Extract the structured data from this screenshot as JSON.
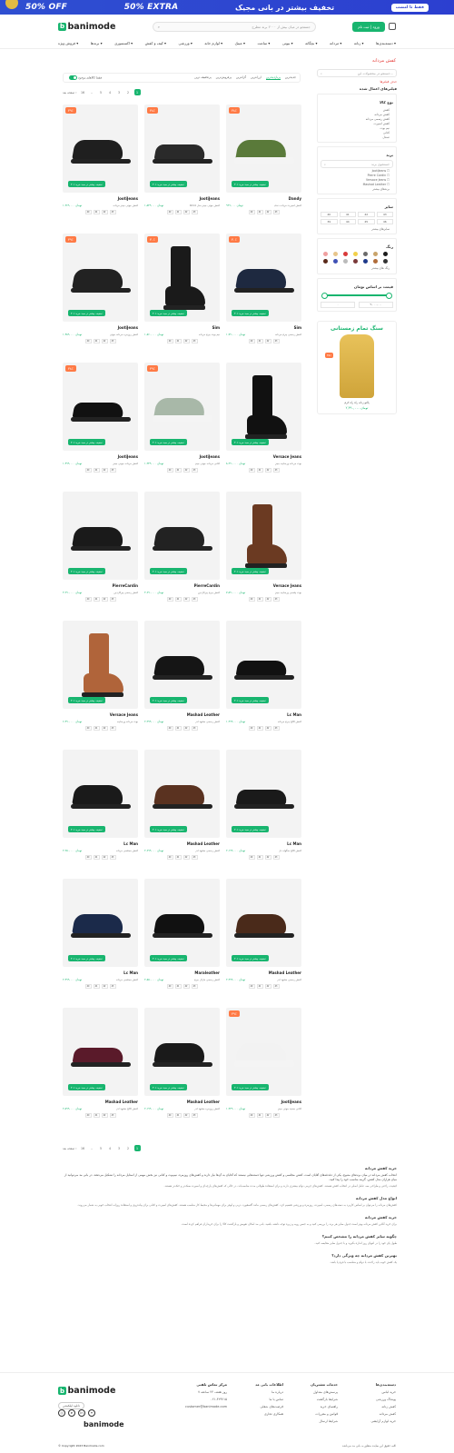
{
  "banner": {
    "cta": "فقط تا امشب",
    "headline": "تخفیف بیشتر در بانی مجیک",
    "extra": "50% EXTRA",
    "off": "50% OFF"
  },
  "header": {
    "logo": "banimode",
    "search_placeholder": "جستجو در میان بیش از ۲۰۰۰ برند مطرح",
    "login": "ورود | ثبت نام"
  },
  "nav": [
    "دسته‌بندی‌ها",
    "زنانه",
    "مردانه",
    "بچگانه",
    "بیوتی",
    "ساعت",
    "عینک",
    "لوازم خانه",
    "ورزشی",
    "کیف و کفش",
    "اکسسوری",
    "برندها",
    "فروش ویژه"
  ],
  "page_title": "کفش مردانه",
  "sidebar": {
    "search_placeholder": "جستجو در محصولات این...",
    "clear": "حذف فیلترها",
    "active_filters": "فیلترهای اعمال شده",
    "category_head": "نوع کالا",
    "categories": [
      "کفش",
      "کفش مردانه",
      "کفش رسمی مردانه",
      "کفش اسپرت",
      "نیم بوت",
      "کتانی",
      "صندل"
    ],
    "brand_head": "برند",
    "brand_search": "جستجوی برند",
    "brands": [
      "JootiJeans",
      "Pierre Cardin",
      "Versace Jeans",
      "Mashad Leather"
    ],
    "more_brands": "برندهای بیشتر",
    "size_head": "سایز",
    "sizes": [
      "40",
      "41",
      "42",
      "43",
      "39",
      "44",
      "45",
      "46"
    ],
    "more_sizes": "سایزهای بیشتر",
    "color_head": "رنگ",
    "colors": [
      "#f0a0a0",
      "#e7c58b",
      "#d93b3b",
      "#f2d04a",
      "#6b6b6b",
      "#c9a46b",
      "#1c1c1c",
      "#5a2a1a",
      "#3f51b5",
      "#bbbbbb",
      "#7a3a3a",
      "#1e3a8a",
      "#b06c3a",
      "#333333"
    ],
    "more_colors": "رنگ های بیشتر",
    "price_head": "قیمت بر اساس تومان",
    "price_min": "۰",
    "price_max": "۹,۰۰۰,۰۰۰",
    "promo_title": "سنگ تمام زمستانی",
    "promo_name": "پالتو زنانه راه راه کرم",
    "promo_price": "۲,۴۹۰,۰۰۰ تومان",
    "promo_off": "۴۵٪"
  },
  "toolbar": {
    "sorts": [
      "جدیدترین",
      "پربازدیدترین",
      "ارزانترین",
      "گرانترین",
      "پرفروش‌ترین",
      "پرتخفیف ترین"
    ],
    "active_sort": "پربازدیدترین",
    "available_only": "فقط کالاهای موجود"
  },
  "pager": {
    "pages": [
      "1",
      "2",
      "3",
      "4",
      "5",
      "..",
      "16"
    ],
    "next": "صفحه بعد"
  },
  "off_label": "۳۰٪ تخفیف بیشتر در سبد خرید",
  "products": [
    {
      "brand": "JootiJeans",
      "badge": "۳۹٪",
      "price": "۱,۳۶۹,۰۰۰ تومان",
      "title": "کفش جوتی جینز مردانه",
      "type": "derby",
      "c": "#1f1f1f"
    },
    {
      "brand": "JootiJeans",
      "badge": "۳۸٪",
      "price": "۱,۵۴۹,۰۰۰ تومان",
      "title": "کفش جوتی جینز مدل 4014",
      "type": "loafer",
      "c": "#2a2a2a"
    },
    {
      "brand": "Dandy",
      "badge": "۳۸٪",
      "price": "۹۹۹,۰۰۰ تومان",
      "title": "کفش اسپرت مردانه دندی",
      "type": "sneaker",
      "c": "#5a7a3a"
    },
    {
      "brand": "JootiJeans",
      "badge": "۳۹٪",
      "price": "۱,۴۸۹,۰۰۰ تومان",
      "title": "کفش روزمره مردانه جوتی",
      "type": "derby",
      "c": "#222"
    },
    {
      "brand": "Sim",
      "badge": "۳۰٪",
      "price": "۱,۸۶۰,۰۰۰ تومان",
      "title": "نیم بوت چرم مردانه",
      "type": "boot",
      "c": "#1a1a1a"
    },
    {
      "brand": "Sim",
      "badge": "۳۰٪",
      "price": "۱,۷۹۰,۰۰۰ تومان",
      "title": "کفش رسمی چرم مردانه",
      "type": "derby",
      "c": "#1e2940"
    },
    {
      "brand": "JootiJeans",
      "badge": "۳۸٪",
      "price": "۱,۴۹۹,۰۰۰ تومان",
      "title": "کفش مردانه جوتی جینز",
      "type": "loafer",
      "c": "#111"
    },
    {
      "brand": "JootiJeans",
      "badge": "۳۹٪",
      "price": "۱,۳۴۹,۰۰۰ تومان",
      "title": "کتانی مردانه جوتی جینز",
      "type": "sneaker",
      "c": "#a8b8a8"
    },
    {
      "brand": "Versace Jeans",
      "badge": "",
      "price": "۸,۲۹۰,۰۰۰ تومان",
      "title": "بوت مردانه ورساچه جینز",
      "type": "boot",
      "c": "#111"
    },
    {
      "brand": "PierreCardin",
      "badge": "",
      "price": "۳,۲۹۰,۰۰۰ تومان",
      "title": "کفش رسمی پیرکاردین",
      "type": "oxford",
      "c": "#1a1a1a"
    },
    {
      "brand": "PierreCardin",
      "badge": "",
      "price": "۳,۶۹۰,۰۰۰ تومان",
      "title": "کفش چرم پیرکاردین",
      "type": "oxford",
      "c": "#222"
    },
    {
      "brand": "Versace Jeans",
      "badge": "",
      "price": "۷,۵۹۰,۰۰۰ تومان",
      "title": "بوت چلسی ورساچه جینز",
      "type": "boot",
      "c": "#6b3a22"
    },
    {
      "brand": "Versace Jeans",
      "badge": "",
      "price": "۶,۴۹۰,۰۰۰ تومان",
      "title": "بوت مردانه ورساچه",
      "type": "boot",
      "c": "#b0643a"
    },
    {
      "brand": "Mashad Leather",
      "badge": "",
      "price": "۲,۳۹۹,۰۰۰ تومان",
      "title": "کفش رسمی مشهد لدر",
      "type": "derby",
      "c": "#151515"
    },
    {
      "brand": "Lc Man",
      "badge": "",
      "price": "۱,۹۹۹,۰۰۰ تومان",
      "title": "کفش کالج چرم مردانه",
      "type": "loafer",
      "c": "#111"
    },
    {
      "brand": "Lc Man",
      "badge": "",
      "price": "۲,۲۵۰,۰۰۰ تومان",
      "title": "کفش مجلسی مردانه",
      "type": "oxford",
      "c": "#1a1a1a"
    },
    {
      "brand": "Mashad Leather",
      "badge": "",
      "price": "۲,۶۹۹,۰۰۰ تومان",
      "title": "کفش رسمی مشهد لدر",
      "type": "oxford",
      "c": "#5a3220"
    },
    {
      "brand": "Lc Man",
      "badge": "",
      "price": "۲,۱۹۹,۰۰۰ تومان",
      "title": "کفش کالج منگوله دار",
      "type": "loafer",
      "c": "#1a1a1a"
    },
    {
      "brand": "Lc Man",
      "badge": "",
      "price": "۲,۴۹۹,۰۰۰ تومان",
      "title": "کفش مجلسی مردانه",
      "type": "oxford",
      "c": "#1b2a4a"
    },
    {
      "brand": "Maraleather",
      "badge": "",
      "price": "۲,۸۵۰,۰۰۰ تومان",
      "title": "کفش رسمی مارال چرم",
      "type": "derby",
      "c": "#111"
    },
    {
      "brand": "Mashad Leather",
      "badge": "",
      "price": "۲,۳۹۹,۰۰۰ تومان",
      "title": "کفش رسمی مشهد لدر",
      "type": "oxford",
      "c": "#4a2a1a"
    },
    {
      "brand": "Mashad Leather",
      "badge": "",
      "price": "۲,۵۹۹,۰۰۰ تومان",
      "title": "کفش کالج مشهد لدر",
      "type": "loafer",
      "c": "#5a1a2a"
    },
    {
      "brand": "Mashad Leather",
      "badge": "",
      "price": "۲,۱۹۹,۰۰۰ تومان",
      "title": "کفش روزمره مشهد لدر",
      "type": "derby",
      "c": "#1a1a1a"
    },
    {
      "brand": "JootiJeans",
      "badge": "۳۹٪",
      "price": "۱,۲۴۹,۰۰۰ تومان",
      "title": "کتانی سفید جوتی جینز",
      "type": "sneaker",
      "c": "#f2f2f2"
    }
  ],
  "article": {
    "h1": "خرید کفش مردانه",
    "p1": "انتخاب کفش مردانه در میان برندهای متنوع، یکی از دغدغه‌های آقایان است. کفش مجلسی و کفش ورزشی تنها دسته‌هایی نیستند که آقایان به آن‌ها نیاز دارند و کفش‌های روزمره، نیم‌بوت و کتانی نیز بخش مهمی از استایل مردانه را تشکیل می‌دهند. در بانی مد می‌توانید از میان هزاران مدل کفش، گزینه مناسب خود را پیدا کنید.",
    "p2": "کیفیت، راحتی و طراحی سه عامل اصلی در انتخاب کفش هستند. کفش‌های چرمی دوام بیشتری دارند و برای استفاده طولانی مدت مناسب‌اند، در حالی که کفش‌های پارچه‌ای و اسپرت سبک‌تر و خنک‌تر هستند.",
    "h2": "انواع مدل کفش مردانه",
    "p3": "کفش‌های مردانه را می‌توان بر اساس کاربرد به دسته‌های رسمی، اسپرت، روزمره و ورزشی تقسیم کرد. کفش‌های رسمی مانند آکسفورد، دربی و لوفر برای مهمانی‌ها و محیط کار مناسب هستند. کفش‌های اسپرت و کتانی برای پیاده‌روی و استفاده روزانه انتخاب خوبی به شمار می‌روند.",
    "h3": "خرید کفش مردانه",
    "p4": "برای خرید آنلاین کفش مردانه بهتر است جدول سایز هر برند را بررسی کنید و به جنس رویه و زیره توجه داشته باشید. بانی مد امکان تعویض و بازگشت کالا را برای خریداران فراهم کرده است.",
    "h4": "چگونه سایز کفش مردانه را مشخص کنیم؟",
    "p5": "طول پای خود را در انتهای روز اندازه بگیرید و با جدول سایز مقایسه کنید.",
    "h5": "بهترین کفش مردانه چه ویژگی دارد؟",
    "p6": "یک کفش خوب باید راحت، با دوام و متناسب با فرم پا باشد."
  },
  "footer": {
    "logo": "banimode",
    "col1_head": "دسته‌بندی‌ها",
    "col1": [
      "خرید لباس",
      "پوشاک ورزشی",
      "کفش زنانه",
      "کفش مردانه",
      "خرید لوازم آرایشی"
    ],
    "col2_head": "خدمات مشتریان",
    "col2": [
      "پرسش‌های متداول",
      "شرایط بازگشت",
      "راهنمای خرید",
      "قوانین و مقررات",
      "شرایط ارسال"
    ],
    "col3_head": "اطلاعات بانی مد",
    "col3": [
      "درباره ما",
      "تماس با ما",
      "فرصت‌های شغلی",
      "همکاری تجاری"
    ],
    "col4_head": "مرکز تماس تلفنی",
    "col4": [
      "۷ روز هفته، ۲۴ ساعته",
      "۰۲۱-۴۲۹۲۱۵",
      "customer@banimode.com"
    ],
    "app": "دانلود اپلیکیشن",
    "copyright": "© Copyright 2023 Banimode.com",
    "rights": "کلیه حقوق این سایت متعلق به بانی مد می‌باشد"
  }
}
